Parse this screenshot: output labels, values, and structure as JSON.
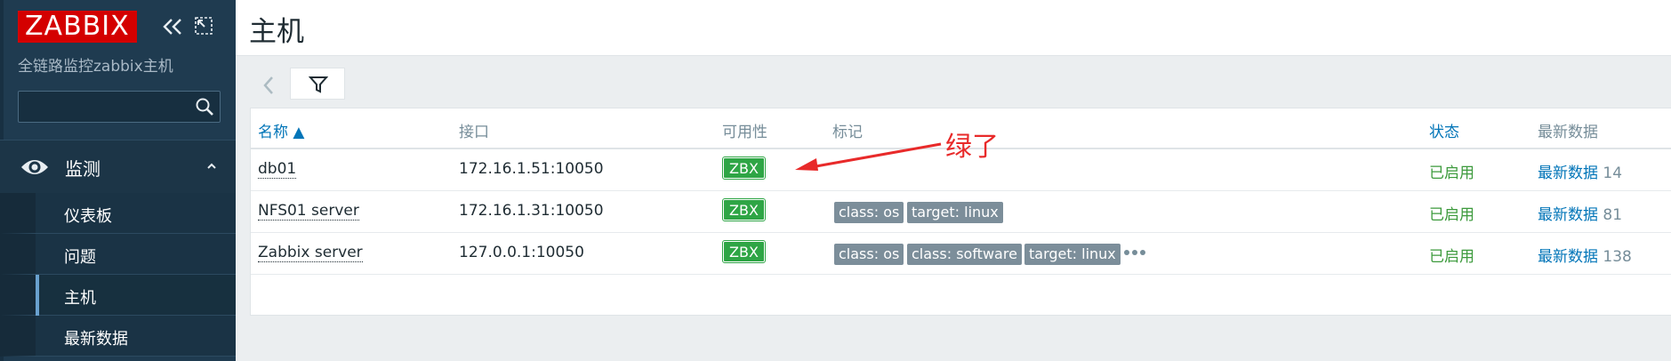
{
  "sidebar": {
    "logo": "ZABBIX",
    "subtitle": "全链路监控zabbix主机",
    "search": {
      "value": "",
      "placeholder": ""
    },
    "section": "监测",
    "items": [
      {
        "label": "仪表板",
        "active": false
      },
      {
        "label": "问题",
        "active": false
      },
      {
        "label": "主机",
        "active": true
      },
      {
        "label": "最新数据",
        "active": false
      }
    ]
  },
  "header": {
    "title": "主机"
  },
  "table": {
    "columns": {
      "name": "名称 ▲",
      "interface": "接口",
      "availability": "可用性",
      "tags": "标记",
      "status": "状态",
      "latest": "最新数据"
    },
    "rows": [
      {
        "name": "db01",
        "interface": "172.16.1.51:10050",
        "availability": "ZBX",
        "tags": [],
        "status": "已启用",
        "latest_label": "最新数据",
        "latest_count": "14"
      },
      {
        "name": "NFS01 server",
        "interface": "172.16.1.31:10050",
        "availability": "ZBX",
        "tags": [
          "class: os",
          "target: linux"
        ],
        "status": "已启用",
        "latest_label": "最新数据",
        "latest_count": "81"
      },
      {
        "name": "Zabbix server",
        "interface": "127.0.0.1:10050",
        "availability": "ZBX",
        "tags": [
          "class: os",
          "class: software",
          "target: linux"
        ],
        "status": "已启用",
        "latest_label": "最新数据",
        "latest_count": "138"
      }
    ]
  },
  "annotation": {
    "text": "绿了",
    "color": "#e82a2a"
  },
  "colors": {
    "sidebar_bg": "#1f3b50",
    "logo_bg": "#d40000",
    "available_green": "#2ea545",
    "link_blue": "#0275b8",
    "status_green": "#3c9a3c",
    "tag_gray": "#7c8e9a"
  },
  "icons": [
    "collapse-icon",
    "kiosk-icon",
    "search-icon",
    "eye-icon",
    "chevron-up-icon",
    "filter-back-icon",
    "filter-icon",
    "more-icon"
  ]
}
